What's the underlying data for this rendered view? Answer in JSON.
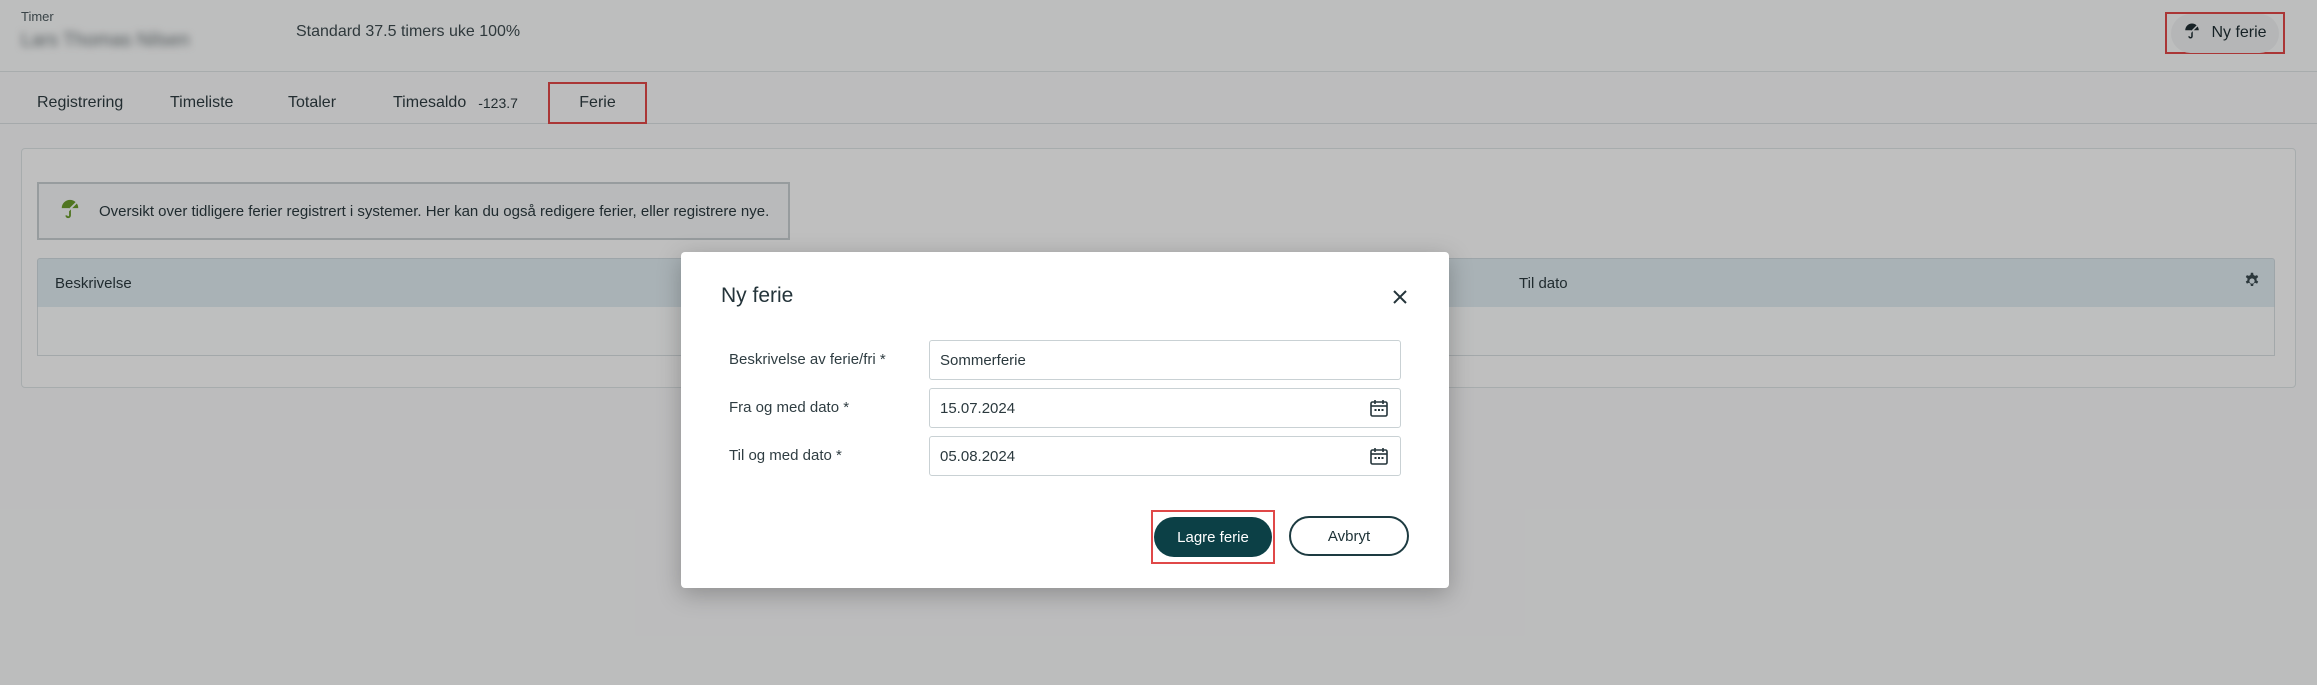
{
  "header": {
    "app_label": "Timer",
    "user_name": "Lars Thomas Nilsen",
    "standard_info": "Standard 37.5 timers uke 100%",
    "new_vacation_button": "Ny ferie"
  },
  "tabs": [
    {
      "label": "Registrering"
    },
    {
      "label": "Timeliste"
    },
    {
      "label": "Totaler"
    },
    {
      "label": "Timesaldo",
      "value": "-123.7"
    },
    {
      "label": "Ferie"
    }
  ],
  "info_box": {
    "text": "Oversikt over tidligere ferier registrert i systemer. Her kan du også redigere ferier, eller registrere nye."
  },
  "table": {
    "columns": [
      "Beskrivelse",
      "Til dato"
    ]
  },
  "modal": {
    "title": "Ny ferie",
    "fields": [
      {
        "label": "Beskrivelse av ferie/fri *",
        "value": "Sommerferie"
      },
      {
        "label": "Fra og med dato *",
        "value": "15.07.2024"
      },
      {
        "label": "Til og med dato *",
        "value": "05.08.2024"
      }
    ],
    "save_label": "Lagre ferie",
    "cancel_label": "Avbryt"
  },
  "colors": {
    "accent": "#0c4046",
    "umbrella_icon": "#6a9a2c",
    "highlight_box": "#e04848"
  },
  "icons": [
    "umbrella-icon",
    "gear-icon",
    "close-icon",
    "calendar-icon"
  ]
}
